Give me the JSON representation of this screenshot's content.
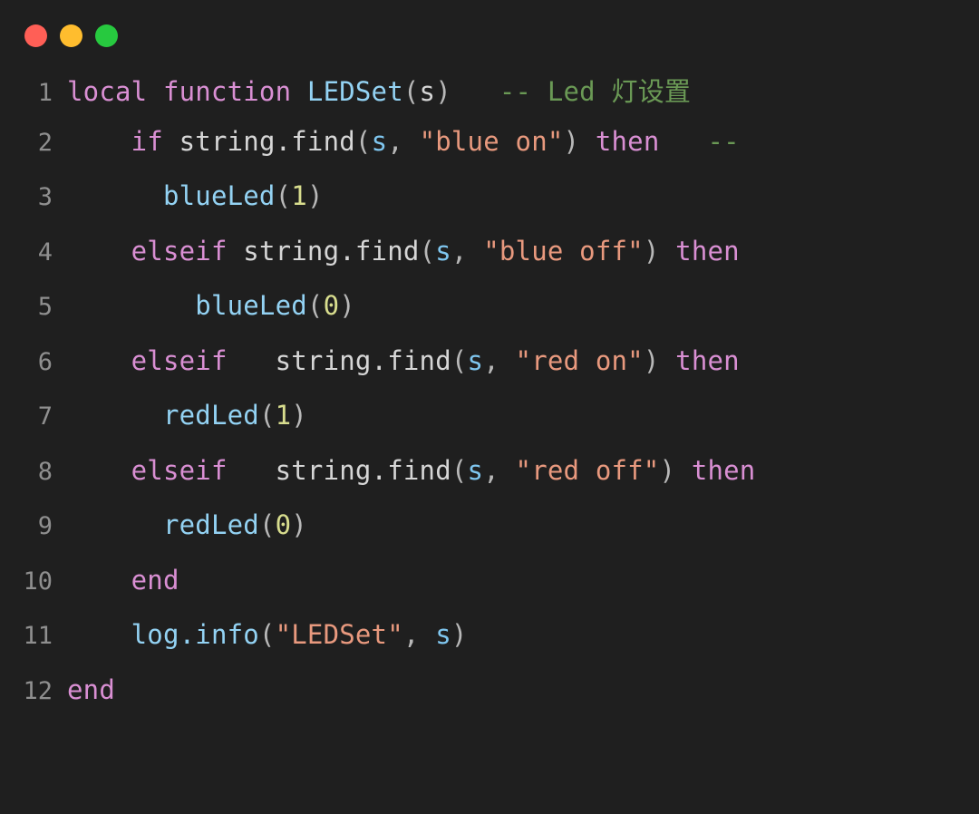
{
  "window": {
    "titlebar": {
      "dots": [
        {
          "name": "close-dot",
          "color": "#ff5f56",
          "label": "close"
        },
        {
          "name": "minimize-dot",
          "color": "#ffbd2e",
          "label": "minimize"
        },
        {
          "name": "maximize-dot",
          "color": "#27c93f",
          "label": "maximize"
        }
      ]
    },
    "background": "#1f1f1f"
  },
  "editor": {
    "language": "lua",
    "gutter_color": "#8f8f8f",
    "theme_colors": {
      "keyword": "#d98fd3",
      "function": "#93d2f3",
      "string": "#e8997e",
      "number": "#d8dd8e",
      "comment": "#6a9955",
      "plain": "#d6d6d6",
      "punctuation": "#b8b8b8",
      "variable": "#7fc6ef"
    },
    "line_numbers": [
      "1",
      "2",
      "3",
      "4",
      "5",
      "6",
      "7",
      "8",
      "9",
      "10",
      "11",
      "12"
    ],
    "lines": [
      {
        "number": "1",
        "text": "local function LEDSet(s)   -- Led 灯设置",
        "tokens": [
          {
            "t": "local function ",
            "c": "kw"
          },
          {
            "t": "LEDSet",
            "c": "fn"
          },
          {
            "t": "(",
            "c": "punc"
          },
          {
            "t": "s",
            "c": "plain"
          },
          {
            "t": ")",
            "c": "punc"
          },
          {
            "t": "   ",
            "c": "plain"
          },
          {
            "t": "-- Led ",
            "c": "cmt"
          },
          {
            "t": "灯设置",
            "c": "cjk"
          }
        ]
      },
      {
        "number": "2",
        "text": "    if string.find(s, \"blue on\") then   --",
        "tokens": [
          {
            "t": "    ",
            "c": "plain"
          },
          {
            "t": "if",
            "c": "kw"
          },
          {
            "t": " ",
            "c": "plain"
          },
          {
            "t": "string.find",
            "c": "plain"
          },
          {
            "t": "(",
            "c": "punc"
          },
          {
            "t": "s",
            "c": "var"
          },
          {
            "t": ", ",
            "c": "punc"
          },
          {
            "t": "\"blue on\"",
            "c": "str"
          },
          {
            "t": ")",
            "c": "punc"
          },
          {
            "t": " ",
            "c": "plain"
          },
          {
            "t": "then",
            "c": "kw"
          },
          {
            "t": "   ",
            "c": "plain"
          },
          {
            "t": "--",
            "c": "cmt"
          }
        ]
      },
      {
        "number": "3",
        "text": "      blueLed(1)",
        "tokens": [
          {
            "t": "      ",
            "c": "plain"
          },
          {
            "t": "blueLed",
            "c": "fn"
          },
          {
            "t": "(",
            "c": "punc"
          },
          {
            "t": "1",
            "c": "num"
          },
          {
            "t": ")",
            "c": "punc"
          }
        ]
      },
      {
        "number": "4",
        "text": "    elseif string.find(s, \"blue off\") then",
        "tokens": [
          {
            "t": "    ",
            "c": "plain"
          },
          {
            "t": "elseif",
            "c": "kw"
          },
          {
            "t": " ",
            "c": "plain"
          },
          {
            "t": "string.find",
            "c": "plain"
          },
          {
            "t": "(",
            "c": "punc"
          },
          {
            "t": "s",
            "c": "var"
          },
          {
            "t": ", ",
            "c": "punc"
          },
          {
            "t": "\"blue off\"",
            "c": "str"
          },
          {
            "t": ")",
            "c": "punc"
          },
          {
            "t": " ",
            "c": "plain"
          },
          {
            "t": "then",
            "c": "kw"
          }
        ]
      },
      {
        "number": "5",
        "text": "        blueLed(0)",
        "tokens": [
          {
            "t": "        ",
            "c": "plain"
          },
          {
            "t": "blueLed",
            "c": "fn"
          },
          {
            "t": "(",
            "c": "punc"
          },
          {
            "t": "0",
            "c": "num"
          },
          {
            "t": ")",
            "c": "punc"
          }
        ]
      },
      {
        "number": "6",
        "text": "    elseif   string.find(s, \"red on\") then",
        "tokens": [
          {
            "t": "    ",
            "c": "plain"
          },
          {
            "t": "elseif",
            "c": "kw"
          },
          {
            "t": "   ",
            "c": "plain"
          },
          {
            "t": "string.find",
            "c": "plain"
          },
          {
            "t": "(",
            "c": "punc"
          },
          {
            "t": "s",
            "c": "var"
          },
          {
            "t": ", ",
            "c": "punc"
          },
          {
            "t": "\"red on\"",
            "c": "str"
          },
          {
            "t": ")",
            "c": "punc"
          },
          {
            "t": " ",
            "c": "plain"
          },
          {
            "t": "then",
            "c": "kw"
          }
        ]
      },
      {
        "number": "7",
        "text": "      redLed(1)",
        "tokens": [
          {
            "t": "      ",
            "c": "plain"
          },
          {
            "t": "redLed",
            "c": "fn"
          },
          {
            "t": "(",
            "c": "punc"
          },
          {
            "t": "1",
            "c": "num"
          },
          {
            "t": ")",
            "c": "punc"
          }
        ]
      },
      {
        "number": "8",
        "text": "    elseif   string.find(s, \"red off\") then",
        "tokens": [
          {
            "t": "    ",
            "c": "plain"
          },
          {
            "t": "elseif",
            "c": "kw"
          },
          {
            "t": "   ",
            "c": "plain"
          },
          {
            "t": "string.find",
            "c": "plain"
          },
          {
            "t": "(",
            "c": "punc"
          },
          {
            "t": "s",
            "c": "var"
          },
          {
            "t": ", ",
            "c": "punc"
          },
          {
            "t": "\"red off\"",
            "c": "str"
          },
          {
            "t": ")",
            "c": "punc"
          },
          {
            "t": " ",
            "c": "plain"
          },
          {
            "t": "then",
            "c": "kw"
          }
        ]
      },
      {
        "number": "9",
        "text": "      redLed(0)",
        "tokens": [
          {
            "t": "      ",
            "c": "plain"
          },
          {
            "t": "redLed",
            "c": "fn"
          },
          {
            "t": "(",
            "c": "punc"
          },
          {
            "t": "0",
            "c": "num"
          },
          {
            "t": ")",
            "c": "punc"
          }
        ]
      },
      {
        "number": "10",
        "text": "    end",
        "tokens": [
          {
            "t": "    ",
            "c": "plain"
          },
          {
            "t": "end",
            "c": "kw"
          }
        ]
      },
      {
        "number": "11",
        "text": "    log.info(\"LEDSet\", s)",
        "tokens": [
          {
            "t": "    ",
            "c": "plain"
          },
          {
            "t": "log.info",
            "c": "fn"
          },
          {
            "t": "(",
            "c": "punc"
          },
          {
            "t": "\"LEDSet\"",
            "c": "str"
          },
          {
            "t": ", ",
            "c": "punc"
          },
          {
            "t": "s",
            "c": "var"
          },
          {
            "t": ")",
            "c": "punc"
          }
        ]
      },
      {
        "number": "12",
        "text": "end",
        "tokens": [
          {
            "t": "end",
            "c": "kw"
          }
        ]
      }
    ]
  }
}
